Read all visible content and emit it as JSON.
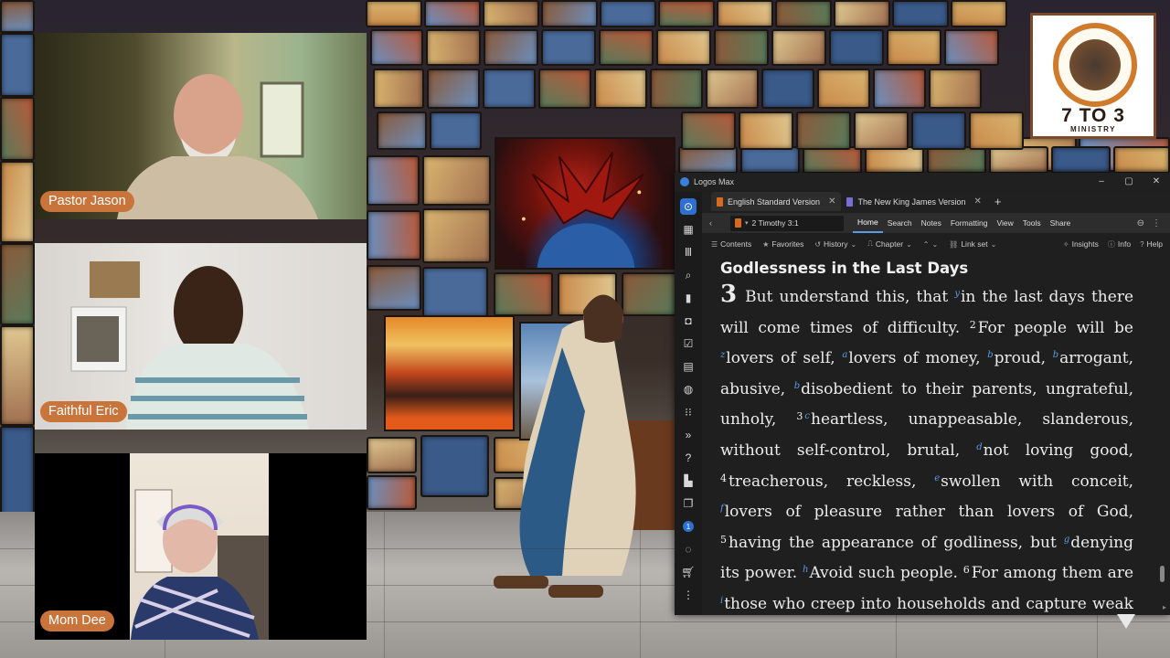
{
  "participants": [
    {
      "name": "Pastor Jason"
    },
    {
      "name": "Faithful Eric"
    },
    {
      "name": "Mom Dee"
    }
  ],
  "logo": {
    "title": "7 TO 3",
    "subtitle": "MINISTRY"
  },
  "logos_app": {
    "window_title": "Logos Max",
    "tabs": [
      {
        "label": "English Standard Version",
        "active": true,
        "color": "#d86a1f"
      },
      {
        "label": "The New King James Version",
        "active": false,
        "color": "#7b6cd8"
      }
    ],
    "reference": "2 Timothy 3:1",
    "menu": [
      "Home",
      "Search",
      "Notes",
      "Formatting",
      "View",
      "Tools",
      "Share"
    ],
    "active_menu": "Home",
    "subbar": {
      "contents": "Contents",
      "favorites": "Favorites",
      "history": "History",
      "chapter": "Chapter",
      "link_set": "Link set",
      "insights": "Insights",
      "info": "Info",
      "help": "Help"
    },
    "sidebar_badge": "1",
    "heading": "Godlessness in the Last Days",
    "passage": {
      "chapter": "3",
      "segments": [
        {
          "t": "But understand this, that "
        },
        {
          "fn": "y"
        },
        {
          "t": "in the last days there will come times of difficulty. "
        },
        {
          "v": "2"
        },
        {
          "t": "For people will be "
        },
        {
          "fn": "z"
        },
        {
          "t": "lovers of self, "
        },
        {
          "fn": "a"
        },
        {
          "t": "lovers of money, "
        },
        {
          "fn": "b"
        },
        {
          "t": "proud, "
        },
        {
          "fn": "b"
        },
        {
          "t": "arrogant, abusive, "
        },
        {
          "fn": "b"
        },
        {
          "t": "disobedient to their parents, ungrateful, unholy, "
        },
        {
          "v": "3"
        },
        {
          "fn": "c"
        },
        {
          "t": "heartless, unappeasable, slanderous, without self-control, brutal, "
        },
        {
          "fn": "d"
        },
        {
          "t": "not loving good, "
        },
        {
          "v": "4"
        },
        {
          "t": "treacherous, reckless, "
        },
        {
          "fn": "e"
        },
        {
          "t": "swollen with conceit, "
        },
        {
          "fn": "f"
        },
        {
          "t": "lovers of pleasure rather than lovers of God, "
        },
        {
          "v": "5"
        },
        {
          "t": "having the appearance of godliness, but "
        },
        {
          "fn": "g"
        },
        {
          "t": "denying its power. "
        },
        {
          "fn": "h"
        },
        {
          "t": "Avoid such people. "
        },
        {
          "v": "6"
        },
        {
          "t": "For among them are "
        },
        {
          "fn": "i"
        },
        {
          "t": "those who creep into households and capture weak women, burdened with sins and"
        }
      ]
    }
  }
}
